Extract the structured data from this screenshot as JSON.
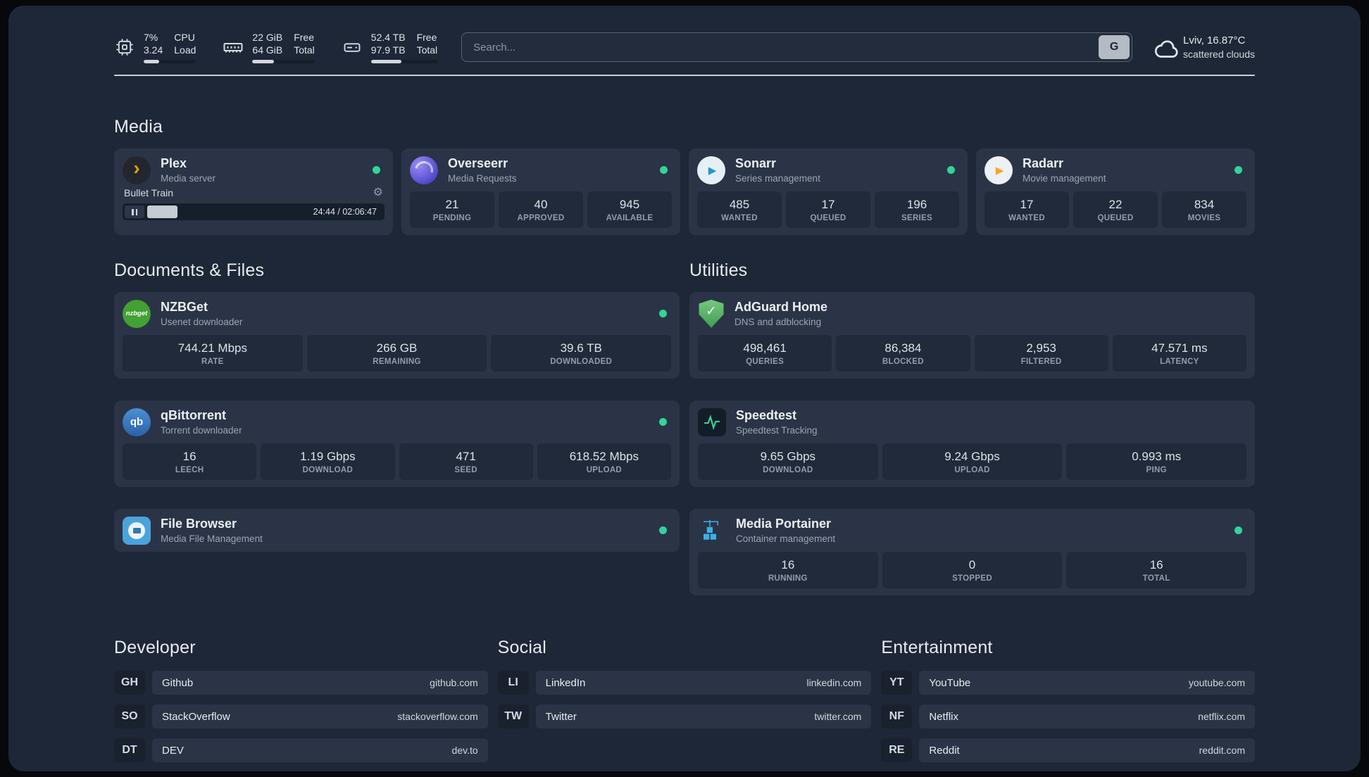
{
  "theme": {
    "background": "#1e2737",
    "card": "#2a3446",
    "tile": "#202a3a",
    "status_green": "#34d399",
    "plex_amber": "#e5a00d"
  },
  "header": {
    "cpu": {
      "value1": "7%",
      "value2": "3.24",
      "label1": "CPU",
      "label2": "Load",
      "bar_percent": 30
    },
    "memory": {
      "value1": "22 GiB",
      "value2": "64 GiB",
      "label1": "Free",
      "label2": "Total",
      "bar_percent": 35
    },
    "disk": {
      "value1": "52.4 TB",
      "value2": "97.9 TB",
      "label1": "Free",
      "label2": "Total",
      "bar_percent": 46
    },
    "search": {
      "placeholder": "Search...",
      "provider": "G"
    },
    "weather": {
      "location": "Lviv, 16.87°C",
      "condition": "scattered clouds"
    }
  },
  "icons": {
    "plex_glyph": "›",
    "sonarr_glyph": "▶",
    "radarr_glyph": "▶",
    "nzbget_text": "nzbget",
    "qb_text": "qb",
    "adguard_glyph": "✓",
    "settings_glyph": "⚙"
  },
  "groups": {
    "media": {
      "title": "Media",
      "plex": {
        "name": "Plex",
        "subtitle": "Media server",
        "now_playing": "Bullet Train",
        "time": "24:44 / 02:06:47",
        "progress_percent": 13
      },
      "overseerr": {
        "name": "Overseerr",
        "subtitle": "Media Requests",
        "stats": [
          {
            "value": "21",
            "label": "PENDING"
          },
          {
            "value": "40",
            "label": "APPROVED"
          },
          {
            "value": "945",
            "label": "AVAILABLE"
          }
        ]
      },
      "sonarr": {
        "name": "Sonarr",
        "subtitle": "Series management",
        "stats": [
          {
            "value": "485",
            "label": "WANTED"
          },
          {
            "value": "17",
            "label": "QUEUED"
          },
          {
            "value": "196",
            "label": "SERIES"
          }
        ]
      },
      "radarr": {
        "name": "Radarr",
        "subtitle": "Movie management",
        "stats": [
          {
            "value": "17",
            "label": "WANTED"
          },
          {
            "value": "22",
            "label": "QUEUED"
          },
          {
            "value": "834",
            "label": "MOVIES"
          }
        ]
      }
    },
    "documents": {
      "title": "Documents & Files",
      "nzbget": {
        "name": "NZBGet",
        "subtitle": "Usenet downloader",
        "stats": [
          {
            "value": "744.21 Mbps",
            "label": "RATE"
          },
          {
            "value": "266 GB",
            "label": "REMAINING"
          },
          {
            "value": "39.6 TB",
            "label": "DOWNLOADED"
          }
        ]
      },
      "qbittorrent": {
        "name": "qBittorrent",
        "subtitle": "Torrent downloader",
        "stats": [
          {
            "value": "16",
            "label": "LEECH"
          },
          {
            "value": "1.19 Gbps",
            "label": "DOWNLOAD"
          },
          {
            "value": "471",
            "label": "SEED"
          },
          {
            "value": "618.52 Mbps",
            "label": "UPLOAD"
          }
        ]
      },
      "filebrowser": {
        "name": "File Browser",
        "subtitle": "Media File Management"
      }
    },
    "utilities": {
      "title": "Utilities",
      "adguard": {
        "name": "AdGuard Home",
        "subtitle": "DNS and adblocking",
        "stats": [
          {
            "value": "498,461",
            "label": "QUERIES"
          },
          {
            "value": "86,384",
            "label": "BLOCKED"
          },
          {
            "value": "2,953",
            "label": "FILTERED"
          },
          {
            "value": "47.571 ms",
            "label": "LATENCY"
          }
        ]
      },
      "speedtest": {
        "name": "Speedtest",
        "subtitle": "Speedtest Tracking",
        "stats": [
          {
            "value": "9.65 Gbps",
            "label": "DOWNLOAD"
          },
          {
            "value": "9.24 Gbps",
            "label": "UPLOAD"
          },
          {
            "value": "0.993 ms",
            "label": "PING"
          }
        ]
      },
      "portainer": {
        "name": "Media Portainer",
        "subtitle": "Container management",
        "stats": [
          {
            "value": "16",
            "label": "RUNNING"
          },
          {
            "value": "0",
            "label": "STOPPED"
          },
          {
            "value": "16",
            "label": "TOTAL"
          }
        ]
      }
    }
  },
  "bookmarks": [
    {
      "title": "Developer",
      "items": [
        {
          "abbr": "GH",
          "name": "Github",
          "url": "github.com"
        },
        {
          "abbr": "SO",
          "name": "StackOverflow",
          "url": "stackoverflow.com"
        },
        {
          "abbr": "DT",
          "name": "DEV",
          "url": "dev.to"
        }
      ]
    },
    {
      "title": "Social",
      "items": [
        {
          "abbr": "LI",
          "name": "LinkedIn",
          "url": "linkedin.com"
        },
        {
          "abbr": "TW",
          "name": "Twitter",
          "url": "twitter.com"
        }
      ]
    },
    {
      "title": "Entertainment",
      "items": [
        {
          "abbr": "YT",
          "name": "YouTube",
          "url": "youtube.com"
        },
        {
          "abbr": "NF",
          "name": "Netflix",
          "url": "netflix.com"
        },
        {
          "abbr": "RE",
          "name": "Reddit",
          "url": "reddit.com"
        }
      ]
    }
  ]
}
